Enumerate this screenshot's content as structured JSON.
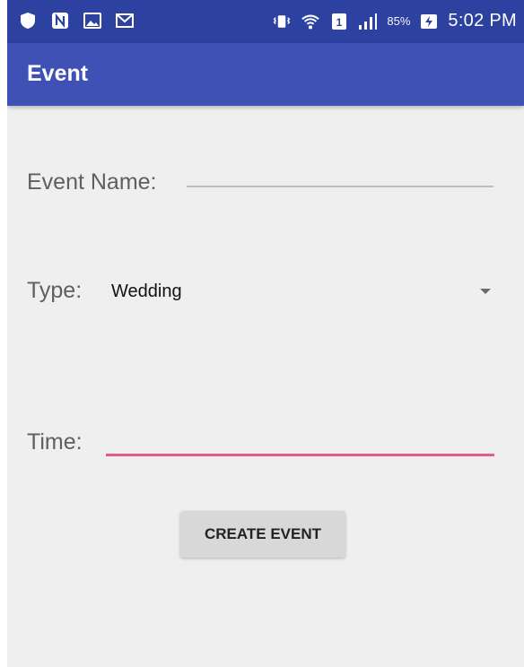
{
  "status_bar": {
    "icons_left": [
      "shield-icon",
      "n-app-icon",
      "image-icon",
      "mail-icon"
    ],
    "icons_right": [
      "vibrate-icon",
      "wifi-icon",
      "sim-icon",
      "signal-icon",
      "battery-icon"
    ],
    "battery_percent": "85%",
    "time": "5:02 PM",
    "background_color": "#2d41a0"
  },
  "app_bar": {
    "title": "Event",
    "color": "#3f51b5"
  },
  "form": {
    "event_name_label": "Event Name:",
    "event_name_value": "",
    "type_label": "Type:",
    "type_selected": "Wedding",
    "time_label": "Time:",
    "time_value": "",
    "focus_accent_color": "#e35d8a"
  },
  "create_button": {
    "label": "CREATE EVENT"
  }
}
